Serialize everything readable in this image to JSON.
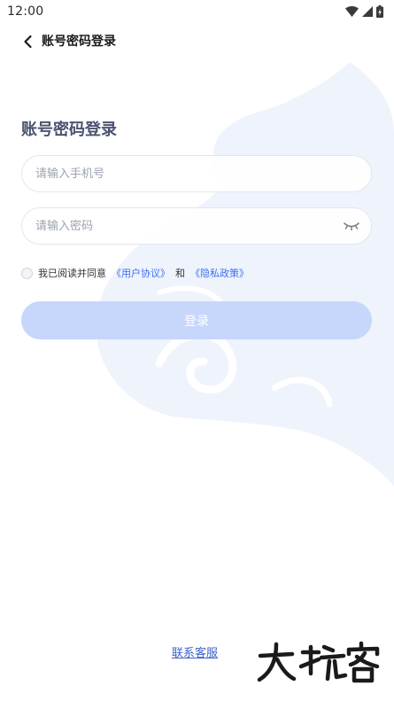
{
  "status_bar": {
    "time": "12:00"
  },
  "nav": {
    "title": "账号密码登录"
  },
  "main": {
    "heading": "账号密码登录",
    "phone_placeholder": "请输入手机号",
    "password_placeholder": "请输入密码",
    "agreement": {
      "prefix": "我已阅读并同意",
      "user_agreement": "《用户协议》",
      "conjunction": "和",
      "privacy_policy": "《隐私政策》"
    },
    "login_label": "登录"
  },
  "footer": {
    "contact_label": "联系客服"
  },
  "watermark": {
    "text": "大玩客"
  },
  "colors": {
    "accent": "#3d6ff5",
    "button_disabled": "#c7d6fb",
    "background_art": "#eef3fc"
  }
}
